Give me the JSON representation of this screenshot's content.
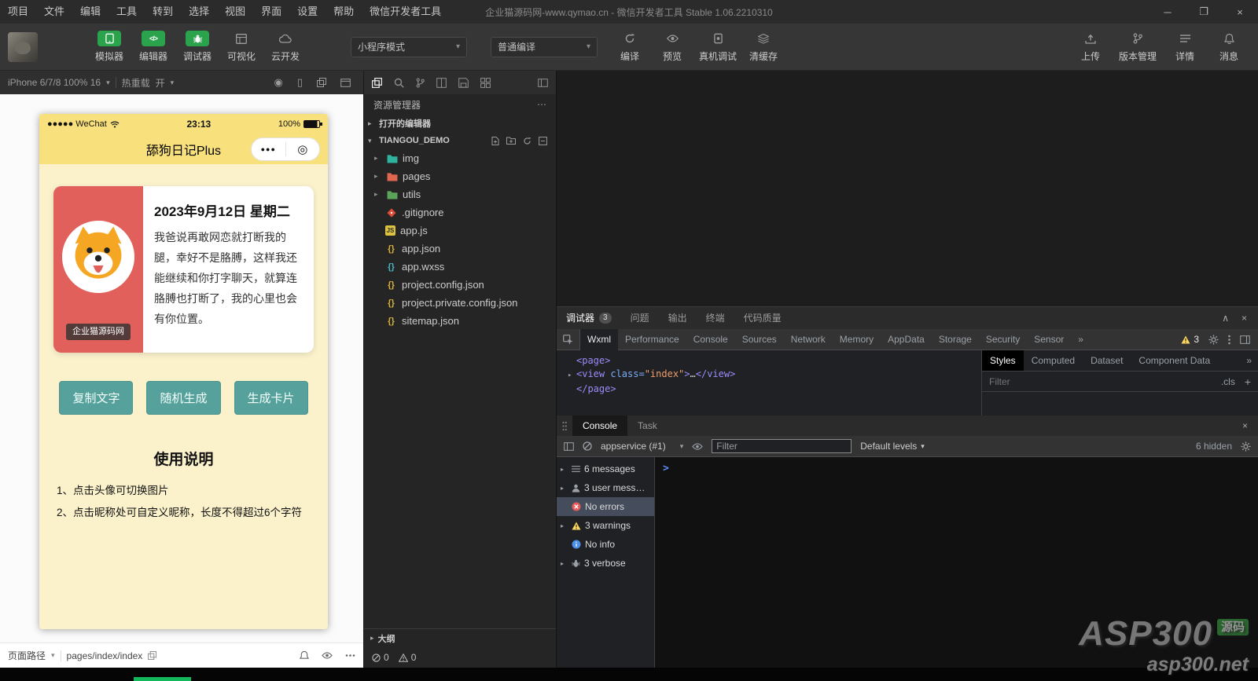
{
  "menubar": {
    "items": [
      "项目",
      "文件",
      "编辑",
      "工具",
      "转到",
      "选择",
      "视图",
      "界面",
      "设置",
      "帮助",
      "微信开发者工具"
    ],
    "title": "企业猫源码网-www.qymao.cn - 微信开发者工具 Stable 1.06.2210310"
  },
  "toolbar": {
    "tools": [
      {
        "label": "模拟器"
      },
      {
        "label": "编辑器"
      },
      {
        "label": "调试器"
      },
      {
        "label": "可视化"
      },
      {
        "label": "云开发"
      }
    ],
    "mode_select": "小程序模式",
    "compile_select": "普通编译",
    "actions": [
      {
        "label": "编译"
      },
      {
        "label": "预览"
      },
      {
        "label": "真机调试"
      },
      {
        "label": "清缓存"
      }
    ],
    "right_actions": [
      {
        "label": "上传"
      },
      {
        "label": "版本管理"
      },
      {
        "label": "详情"
      },
      {
        "label": "消息"
      }
    ],
    "accent_green": "#2ba24c"
  },
  "simulator": {
    "device_select": "iPhone 6/7/8 100% 16",
    "hot_reload_label": "热重载",
    "hot_reload_state": "开",
    "phone": {
      "carrier": "●●●●● WeChat",
      "time": "23:13",
      "battery": "100%",
      "nav_title": "舔狗日记Plus",
      "capsule_dots": "●●●",
      "capsule_target": "◎",
      "card": {
        "date": "2023年9月12日 星期二",
        "content": "我爸说再敢网恋就打断我的腿，幸好不是胳膊，这样我还能继续和你打字聊天，就算连胳膊也打断了，我的心里也会有你位置。",
        "badge": "企业猫源码网"
      },
      "buttons": [
        "复制文字",
        "随机生成",
        "生成卡片"
      ],
      "usage_title": "使用说明",
      "usage_items": [
        "1、点击头像可切换图片",
        "2、点击昵称处可自定义昵称，长度不得超过6个字符"
      ],
      "theme": {
        "header_yellow": "#f8e17c",
        "body_cream": "#fbf2cc",
        "card_red": "#e2605b",
        "button_teal": "#57a19c"
      }
    },
    "footer": {
      "path_label": "页面路径",
      "path_value": "pages/index/index"
    }
  },
  "explorer": {
    "title": "资源管理器",
    "open_editors_label": "打开的编辑器",
    "project_name": "TIANGOU_DEMO",
    "files": [
      {
        "name": "img",
        "icon": "folder-icon"
      },
      {
        "name": "pages",
        "icon": "folder-icon"
      },
      {
        "name": "utils",
        "icon": "folder-icon"
      },
      {
        "name": ".gitignore",
        "icon": "git-icon"
      },
      {
        "name": "app.js",
        "icon": "js-file-icon"
      },
      {
        "name": "app.json",
        "icon": "json-file-icon"
      },
      {
        "name": "app.wxss",
        "icon": "wxss-file-icon"
      },
      {
        "name": "project.config.json",
        "icon": "json-file-icon"
      },
      {
        "name": "project.private.config.json",
        "icon": "json-file-icon"
      },
      {
        "name": "sitemap.json",
        "icon": "json-file-icon"
      }
    ],
    "outline_label": "大纲",
    "status": {
      "errors": "0",
      "warnings": "0"
    }
  },
  "debugger": {
    "panel_tabs": [
      {
        "label": "调试器",
        "badge": "3"
      },
      {
        "label": "问题"
      },
      {
        "label": "输出"
      },
      {
        "label": "终端"
      },
      {
        "label": "代码质量"
      }
    ],
    "devtools_tabs": [
      "Wxml",
      "Performance",
      "Console",
      "Sources",
      "Network",
      "Memory",
      "AppData",
      "Storage",
      "Security",
      "Sensor"
    ],
    "overflow_glyph": "»",
    "warning_count": "3",
    "dom": {
      "line1": "<page>",
      "line2": {
        "open": "<view",
        "attr": " class=",
        "value": "\"index\"",
        "close": ">",
        "ellipsis": "…",
        "end": "</view>"
      },
      "line3": "</page>"
    },
    "styles": {
      "tabs": [
        "Styles",
        "Computed",
        "Dataset",
        "Component Data"
      ],
      "filter": "Filter",
      "cls": ".cls"
    },
    "console": {
      "tabs": [
        "Console",
        "Task"
      ],
      "context": "appservice (#1)",
      "filter_placeholder": "Filter",
      "levels": "Default levels",
      "hidden_label": "6 hidden",
      "prompt": ">",
      "sidebar": [
        {
          "label": "6 messages"
        },
        {
          "label": "3 user mess…"
        },
        {
          "label": "No errors",
          "selected": true
        },
        {
          "label": "3 warnings"
        },
        {
          "label": "No info"
        },
        {
          "label": "3 verbose"
        }
      ]
    }
  },
  "watermark": {
    "line1": "ASP300",
    "badge": "源码",
    "line2": "asp300.net"
  }
}
